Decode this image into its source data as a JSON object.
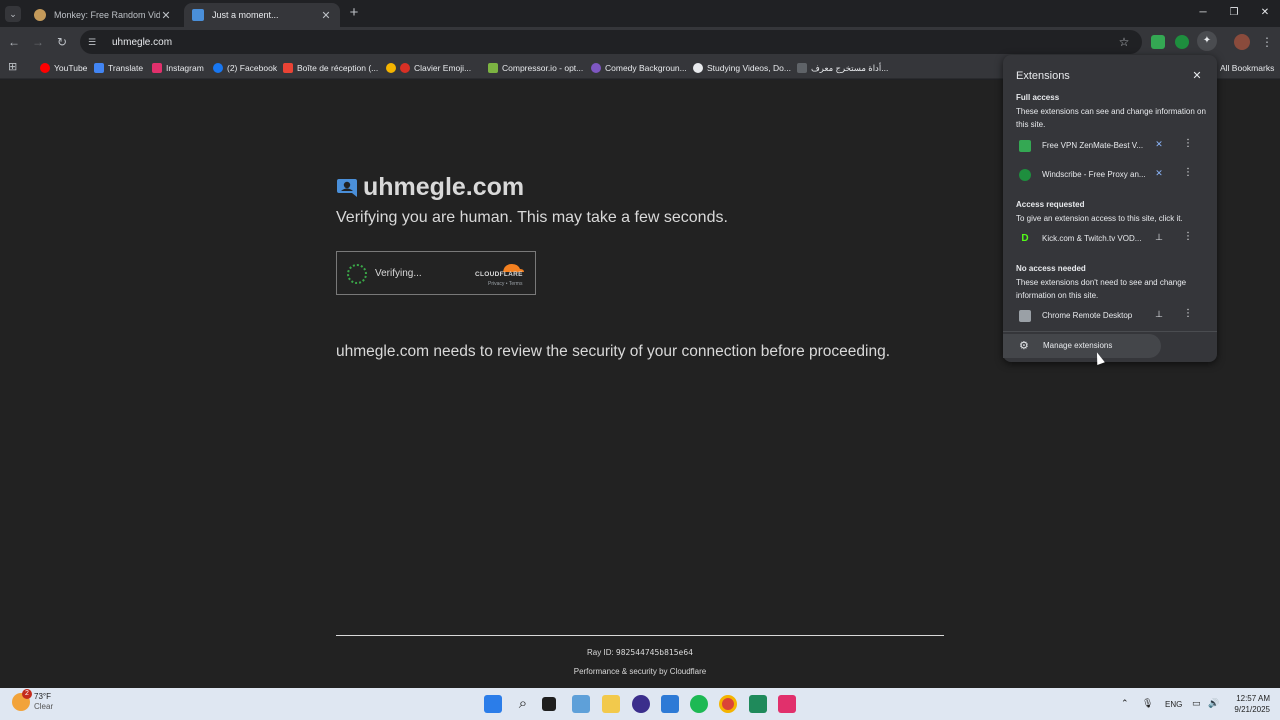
{
  "browser": {
    "tabs": [
      {
        "title": "Monkey: Free Random Video C",
        "active": false
      },
      {
        "title": "Just a moment...",
        "active": true
      }
    ],
    "close_glyph": "✕",
    "new_tab_glyph": "+",
    "url": "uhmegle.com",
    "window_controls": {
      "minimize": "─",
      "maximize": "❐",
      "close": "✕"
    }
  },
  "bookmarks": {
    "items": [
      {
        "label": "YouTube",
        "icon": "youtube-icon",
        "color": "#ff0000"
      },
      {
        "label": "Translate",
        "icon": "translate-icon",
        "color": "#4285f4"
      },
      {
        "label": "Instagram",
        "icon": "instagram-icon",
        "color": "#e1306c"
      },
      {
        "label": "(2) Facebook",
        "icon": "facebook-icon",
        "color": "#1877f2"
      },
      {
        "label": "Boîte de réception (...",
        "icon": "gmail-icon",
        "color": "#ea4335"
      },
      {
        "label": "",
        "icon": "emoji-icon",
        "color": "#f4b400"
      },
      {
        "label": "Clavier Emoji...",
        "icon": "keyboard-icon",
        "color": "#e8eaed"
      },
      {
        "label": "Compressor.io - opt...",
        "icon": "compressor-icon",
        "color": "#7cb342"
      },
      {
        "label": "Comedy Backgroun...",
        "icon": "comedy-icon",
        "color": "#7e57c2"
      },
      {
        "label": "Studying Videos, Do...",
        "icon": "study-icon",
        "color": "#e8eaed"
      },
      {
        "label": "أداة مستخرج معرف...",
        "icon": "extractor-icon",
        "color": "#5f6368"
      }
    ],
    "all_bookmarks": "All Bookmarks"
  },
  "page": {
    "site_title": "uhmegle.com",
    "verify_message": "Verifying you are human. This may take a few seconds.",
    "widget": {
      "status": "Verifying...",
      "brand": "CLOUDFLARE",
      "links": "Privacy • Terms"
    },
    "review_message": "uhmegle.com needs to review the security of your connection before proceeding.",
    "ray_label": "Ray ID:",
    "ray_id": "982544745b815e64",
    "perf_prefix": "Performance & security by",
    "perf_brand": "Cloudflare"
  },
  "extensions_popup": {
    "title": "Extensions",
    "close_glyph": "✕",
    "full_access": {
      "heading": "Full access",
      "desc": "These extensions can see and change information on this site.",
      "items": [
        {
          "name": "Free VPN ZenMate-Best V...",
          "color": "#34a853",
          "pinned": true
        },
        {
          "name": "Windscribe - Free Proxy an...",
          "color": "#1e8e3e",
          "pinned": true
        }
      ]
    },
    "access_requested": {
      "heading": "Access requested",
      "desc": "To give an extension access to this site, click it.",
      "items": [
        {
          "name": "Kick.com & Twitch.tv VOD...",
          "color": "#53fc18",
          "pinned": false
        }
      ]
    },
    "no_access": {
      "heading": "No access needed",
      "desc": "These extensions don't need to see and change information on this site.",
      "items": [
        {
          "name": "Chrome Remote Desktop",
          "color": "#9aa0a6",
          "pinned": false
        }
      ]
    },
    "manage_label": "Manage extensions"
  },
  "taskbar": {
    "temp": "73°F",
    "condition": "Clear",
    "notification_count": "2",
    "language": "ENG",
    "time": "12:57 AM",
    "date": "9/21/2025"
  }
}
